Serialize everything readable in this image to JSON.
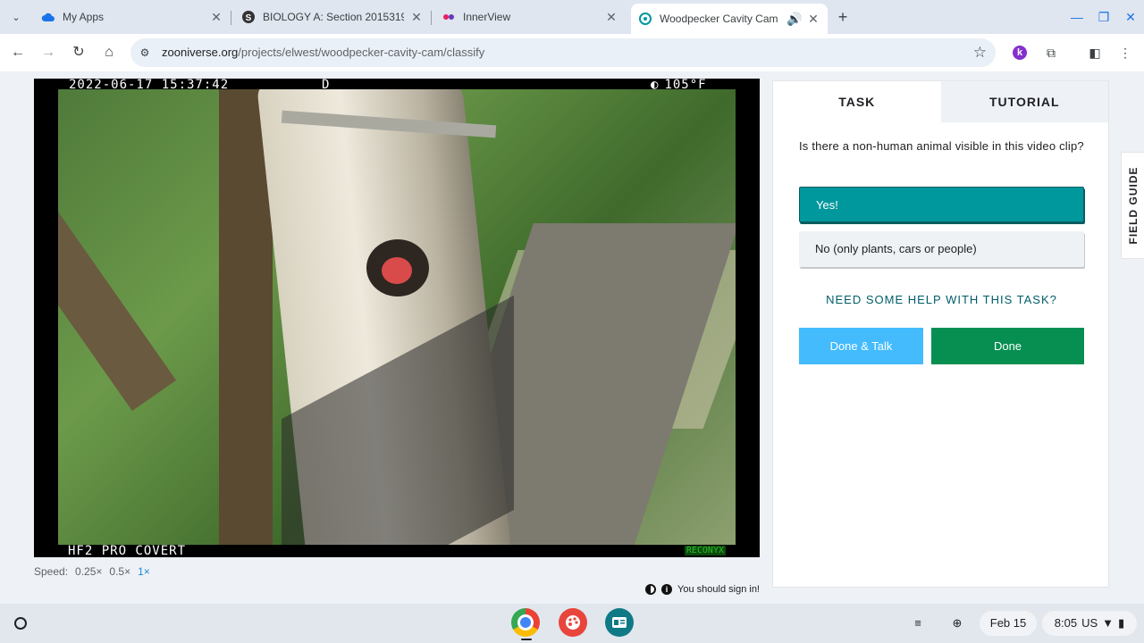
{
  "tabs": [
    {
      "title": "My Apps",
      "favicon": "cloud-icon"
    },
    {
      "title": "BIOLOGY A: Section 20153194",
      "favicon": "schoology-icon"
    },
    {
      "title": "InnerView",
      "favicon": "innerview-icon"
    },
    {
      "title": "Woodpecker Cavity Cam",
      "favicon": "zooniverse-icon",
      "active": true
    }
  ],
  "omnibox": {
    "domain": "zooniverse.org",
    "path": "/projects/elwest/woodpecker-cavity-cam/classify"
  },
  "video": {
    "timestamp": "2022-06-17 15:37:42",
    "mode": "D",
    "temperature": "105°F",
    "camera_model": "HF2 PRO COVERT",
    "brand": "RECONYX"
  },
  "speed": {
    "label": "Speed:",
    "options": [
      "0.25×",
      "0.5×",
      "1×"
    ],
    "selected": "1×"
  },
  "signin_text": "You should sign in!",
  "panel": {
    "tab_task": "TASK",
    "tab_tutorial": "TUTORIAL",
    "question": "Is there a non-human animal visible in this video clip?",
    "answers": [
      "Yes!",
      "No (only plants, cars or people)"
    ],
    "selected_answer": "Yes!",
    "help": "NEED SOME HELP WITH THIS TASK?",
    "done_talk": "Done & Talk",
    "done": "Done"
  },
  "field_guide": "FIELD GUIDE",
  "shelf": {
    "date": "Feb 15",
    "time": "8:05",
    "locale": "US"
  },
  "colors": {
    "accent_teal": "#00979d",
    "done_green": "#078f52",
    "talk_blue": "#43bbfd",
    "help_text": "#005d69"
  }
}
